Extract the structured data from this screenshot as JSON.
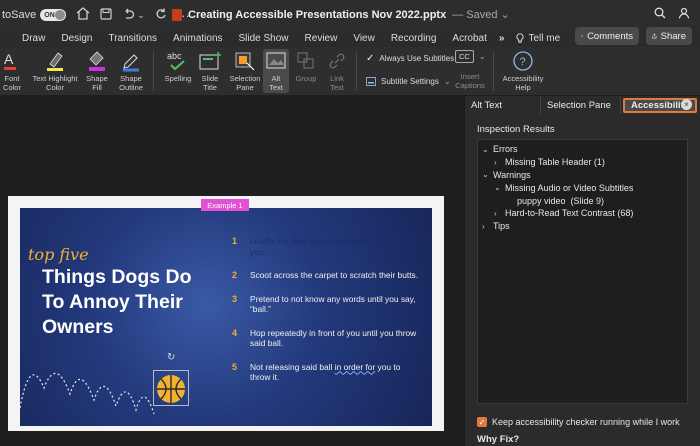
{
  "titlebar": {
    "autosave_label": "toSave",
    "autosave_state": "ON",
    "doc_title": "Creating Accessible Presentations Nov 2022.pptx",
    "saved_status": "— Saved",
    "saved_chevron": "⌄"
  },
  "tabs": [
    "Draw",
    "Design",
    "Transitions",
    "Animations",
    "Slide Show",
    "Review",
    "View",
    "Recording",
    "Acrobat"
  ],
  "tabs_more": "»",
  "tell_me": "Tell me",
  "comments_label": "Comments",
  "share_label": "Share",
  "ribbon": {
    "font_color": "Font\nColor",
    "text_highlight": "Text Highlight\nColor",
    "shape_fill": "Shape\nFill",
    "shape_outline": "Shape\nOutline",
    "spelling": "Spelling",
    "slide_title": "Slide\nTitle",
    "selection_pane": "Selection\nPane",
    "alt_text": "Alt\nText",
    "group": "Group",
    "link_text": "Link\nText",
    "always_use_subtitles": "Always Use Subtitles",
    "subtitle_settings": "Subtitle Settings",
    "insert_captions": "Insert\nCaptions",
    "accessibility_help": "Accessibility\nHelp",
    "abc": "abc",
    "cc": "CC"
  },
  "slide": {
    "example_tag": "Example 1",
    "top_five": "top five",
    "headline": "Things Dogs Do To Annoy Their Owners",
    "items": [
      {
        "num": "1",
        "text": "Loudly lick their feet while sitting right next to you."
      },
      {
        "num": "2",
        "text": "Scoot across the carpet to scratch their butts."
      },
      {
        "num": "3",
        "text": "Pretend to not know any words until you say, “ball.”"
      },
      {
        "num": "4",
        "text": "Hop repeatedly in front of you until you throw said ball."
      },
      {
        "num": "5",
        "text_a": "Not releasing said ball ",
        "text_b": "in order for",
        "text_c": " you to throw it."
      }
    ]
  },
  "pane": {
    "tab_alt_text": "Alt Text",
    "tab_selection_pane": "Selection Pane",
    "tab_accessibility": "Accessibility",
    "close": "×",
    "inspection_title": "Inspection Results",
    "tree": {
      "errors": "Errors",
      "missing_table_header": "Missing Table Header (1)",
      "warnings": "Warnings",
      "missing_av_subtitles": "Missing Audio or Video Subtitles",
      "puppy_video": "puppy video  (Slide 9)",
      "hard_to_read": "Hard-to-Read Text Contrast (68)",
      "tips": "Tips"
    },
    "keep_running": "Keep accessibility checker running while I work",
    "why_fix": "Why Fix?"
  },
  "colors": {
    "accent_orange": "#e27a3f",
    "slide_blue": "#23397c",
    "gold": "#f2b230",
    "magenta_tag": "#e250d6"
  }
}
